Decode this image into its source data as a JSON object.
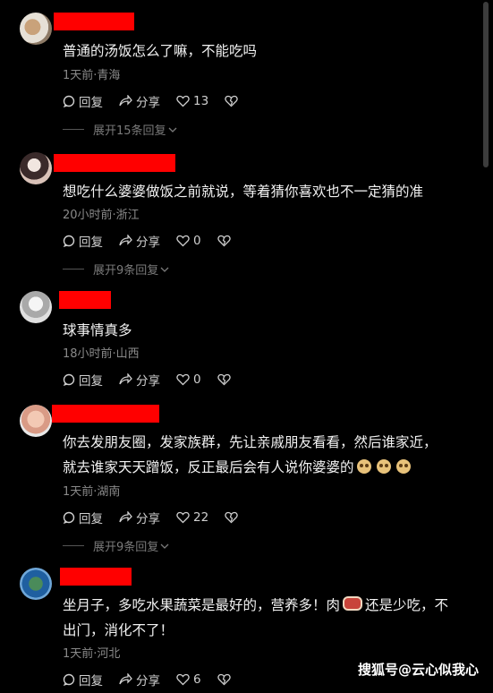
{
  "comments": [
    {
      "text": "普通的汤饭怎么了嘛，不能吃吗",
      "meta": "1天前·青海",
      "reply_label": "回复",
      "share_label": "分享",
      "likes": "13",
      "expand": "展开15条回复"
    },
    {
      "text": "想吃什么婆婆做饭之前就说，等着猜你喜欢也不一定猜的准",
      "meta": "20小时前·浙江",
      "reply_label": "回复",
      "share_label": "分享",
      "likes": "0",
      "expand": "展开9条回复"
    },
    {
      "text": "球事情真多",
      "meta": "18小时前·山西",
      "reply_label": "回复",
      "share_label": "分享",
      "likes": "0"
    },
    {
      "text_line1": "你去发朋友圈，发家族群，先让亲戚朋友看看，然后谁家近，",
      "text_line2": "就去谁家天天蹭饭，反正最后会有人说你婆婆的",
      "meta": "1天前·湖南",
      "reply_label": "回复",
      "share_label": "分享",
      "likes": "22",
      "expand": "展开9条回复"
    },
    {
      "text_line1a": "坐月子，多吃水果蔬菜是最好的，营养多！肉",
      "text_line1b": "还是少吃，不",
      "text_line2": "出门，消化不了！",
      "meta": "1天前·河北",
      "reply_label": "回复",
      "share_label": "分享",
      "likes": "6"
    }
  ],
  "watermark": "搜狐号@云心似我心",
  "colors": {
    "name_redaction": "#ff0000",
    "background": "#000000"
  }
}
